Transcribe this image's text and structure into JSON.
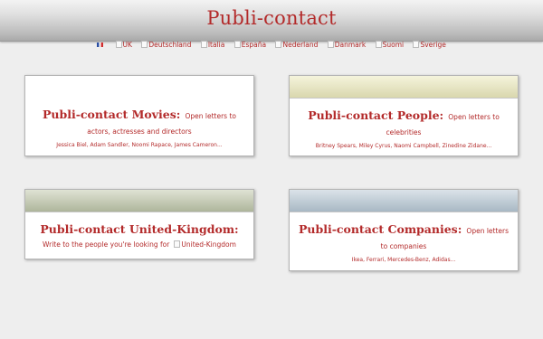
{
  "header": {
    "title": "Publi-contact"
  },
  "languages": [
    {
      "label": "",
      "type": "fr"
    },
    {
      "label": "UK"
    },
    {
      "label": "Deutschland"
    },
    {
      "label": "Italia"
    },
    {
      "label": "España"
    },
    {
      "label": "Nederland"
    },
    {
      "label": "Danmark"
    },
    {
      "label": "Suomi"
    },
    {
      "label": "Sverige"
    }
  ],
  "cards": {
    "movies": {
      "title": "Publi-contact Movies:",
      "desc": "Open letters to actors, actresses and directors",
      "names": "Jessica Biel, Adam Sandler, Noomi Rapace, James Cameron..."
    },
    "people": {
      "title": "Publi-contact People:",
      "desc": "Open letters to celebrities",
      "names": "Britney Spears, Miley Cyrus, Naomi Campbell, Zinedine Zidane..."
    },
    "uk": {
      "title": "Publi-contact United-Kingdom:",
      "desc": "Write to the people you're looking for",
      "img_alt": "United-Kingdom"
    },
    "companies": {
      "title": "Publi-contact Companies:",
      "desc": "Open letters to companies",
      "names": "Ikea, Ferrari, Mercedes-Benz, Adidas..."
    }
  },
  "colors": {
    "accent": "#b32a2a",
    "background": "#eeeeee"
  }
}
